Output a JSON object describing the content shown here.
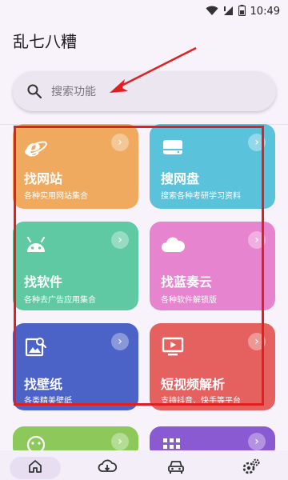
{
  "status_bar": {
    "time": "10:49"
  },
  "app": {
    "title": "乱七八糟"
  },
  "search": {
    "placeholder": "搜索功能"
  },
  "cards": [
    {
      "title": "找网站",
      "subtitle": "各种实用网站集合",
      "icon": "ie-icon",
      "color": "#efaa5f"
    },
    {
      "title": "搜网盘",
      "subtitle": "搜索各种考研学习资料",
      "icon": "drive-icon",
      "color": "#5bc2dc"
    },
    {
      "title": "找软件",
      "subtitle": "各种去广告应用集合",
      "icon": "android-icon",
      "color": "#5ec9a3"
    },
    {
      "title": "找蓝奏云",
      "subtitle": "各种软件解锁版",
      "icon": "cloud-icon",
      "color": "#e684cf"
    },
    {
      "title": "找壁纸",
      "subtitle": "各类精美壁纸",
      "icon": "image-search-icon",
      "color": "#4b62c6"
    },
    {
      "title": "短视频解析",
      "subtitle": "支持抖音、快手等平台",
      "icon": "tv-icon",
      "color": "#e5615f"
    },
    {
      "title": "",
      "subtitle": "",
      "icon": "smile-icon",
      "color": "#8cc95a"
    },
    {
      "title": "",
      "subtitle": "",
      "icon": "grid-icon",
      "color": "#8a5ad2"
    }
  ],
  "annotation": {
    "color": "#e02020"
  },
  "bottom_nav": [
    {
      "icon": "home-icon",
      "active": true
    },
    {
      "icon": "cloud-download-icon",
      "active": false
    },
    {
      "icon": "car-icon",
      "active": false
    },
    {
      "icon": "settings-icon",
      "active": false
    }
  ]
}
